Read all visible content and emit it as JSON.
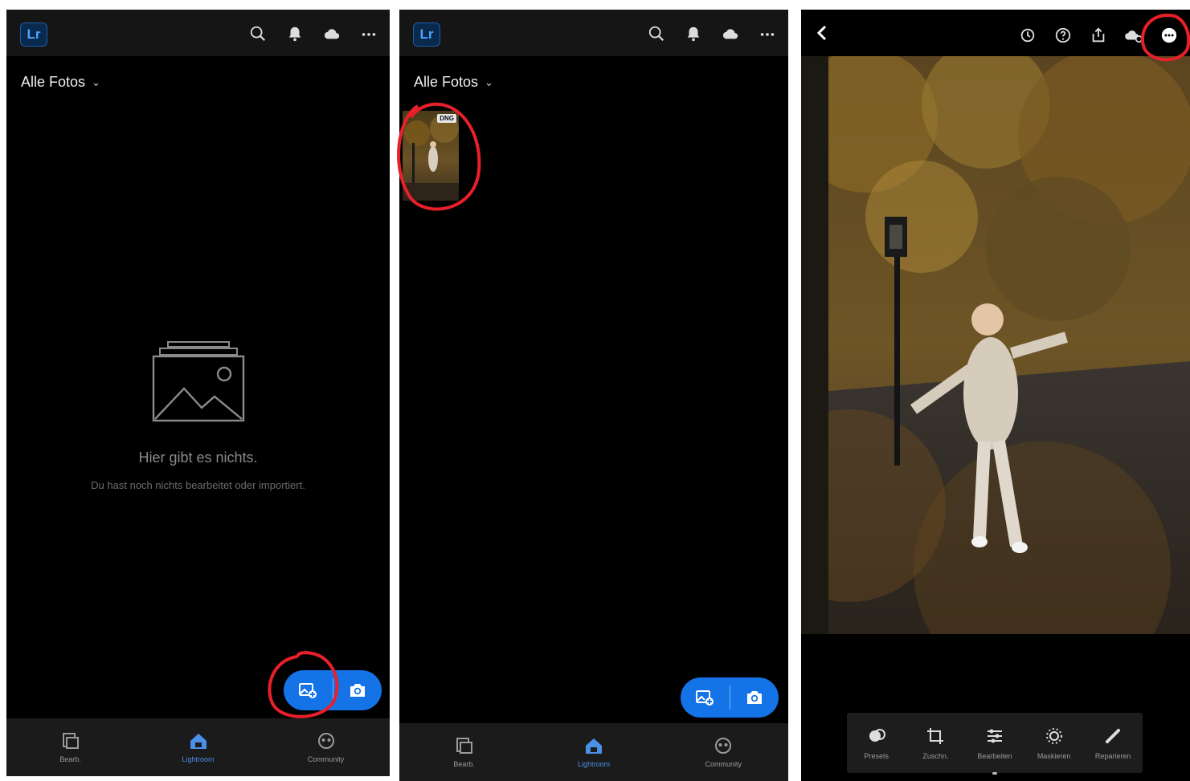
{
  "screens": [
    {
      "logo": "Lr",
      "header_icons": [
        "search-icon",
        "bell-icon",
        "cloud-icon",
        "more-icon"
      ],
      "album_title": "Alle Fotos",
      "empty_title": "Hier gibt es nichts.",
      "empty_subtitle": "Du hast noch nichts bearbeitet oder importiert.",
      "fab": [
        "add-photo-icon",
        "camera-icon"
      ],
      "nav": [
        {
          "icon": "library-icon",
          "label": "Bearb.",
          "active": false
        },
        {
          "icon": "lightroom-home-icon",
          "label": "Lightroom",
          "active": true
        },
        {
          "icon": "community-icon",
          "label": "Community",
          "active": false
        }
      ]
    },
    {
      "logo": "Lr",
      "album_title": "Alle Fotos",
      "thumbnail_badge": "DNG",
      "nav": [
        {
          "icon": "library-icon",
          "label": "Bearb.",
          "active": false
        },
        {
          "icon": "lightroom-home-icon",
          "label": "Lightroom",
          "active": true
        },
        {
          "icon": "community-icon",
          "label": "Community",
          "active": false
        }
      ]
    },
    {
      "header_icons": [
        "history-icon",
        "help-icon",
        "share-icon",
        "cloud-sync-icon",
        "more-circle-icon"
      ],
      "tools": [
        {
          "icon": "presets-icon",
          "label": "Presets"
        },
        {
          "icon": "crop-icon",
          "label": "Zuschn."
        },
        {
          "icon": "edit-icon",
          "label": "Bearbeiten"
        },
        {
          "icon": "masking-icon",
          "label": "Maskieren"
        },
        {
          "icon": "healing-icon",
          "label": "Reparieren"
        }
      ]
    }
  ],
  "colors": {
    "accent": "#1473e6",
    "annotation": "#e8202a",
    "background": "#000000",
    "bar": "#151515"
  }
}
